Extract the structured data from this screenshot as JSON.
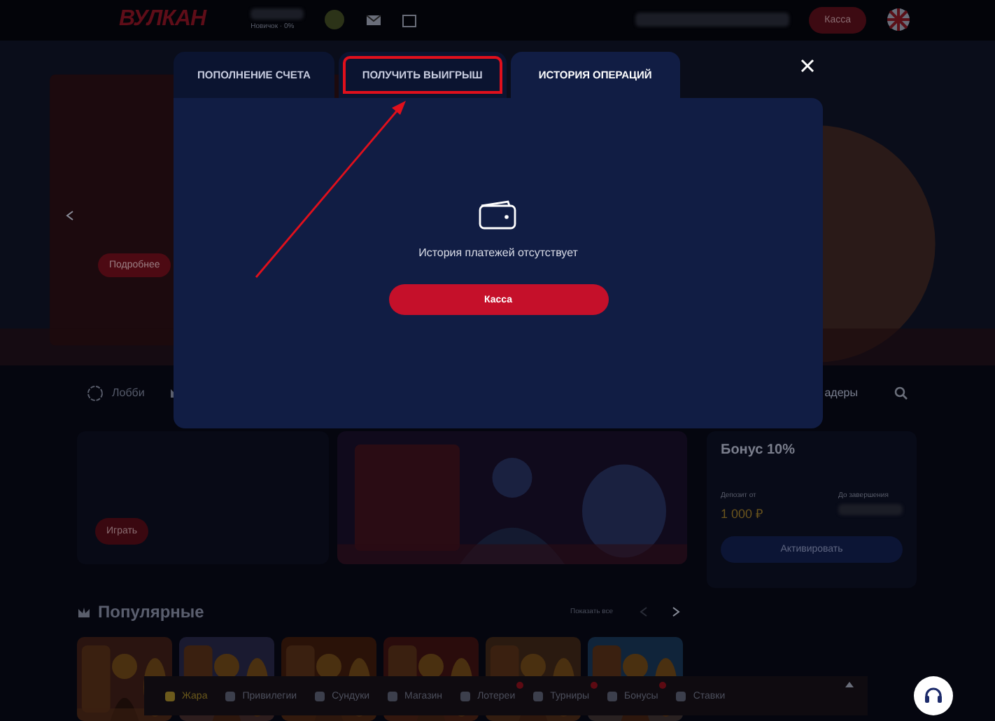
{
  "header": {
    "logo": "ВУЛКАН",
    "status": "Новичок · 0%",
    "cashier": "Касса"
  },
  "hero": {
    "button": "Подробнее"
  },
  "nav": {
    "items": [
      {
        "label": "Лобби"
      }
    ],
    "cut_label": "адеры"
  },
  "promo": {
    "button": "Играть"
  },
  "bonus": {
    "title": "Бонус 10%",
    "deposit_label": "Депозит от",
    "deposit": "1 000 ₽",
    "ends_label": "До завершения",
    "button": "Активировать"
  },
  "popular": {
    "title": "Популярные",
    "show_all": "Показать все"
  },
  "bottom_bar": {
    "items": [
      {
        "label": "Жара",
        "selected": true,
        "badge": false
      },
      {
        "label": "Привилегии",
        "selected": false,
        "badge": false
      },
      {
        "label": "Сундуки",
        "selected": false,
        "badge": false
      },
      {
        "label": "Магазин",
        "selected": false,
        "badge": false
      },
      {
        "label": "Лотереи",
        "selected": false,
        "badge": true
      },
      {
        "label": "Турниры",
        "selected": false,
        "badge": true
      },
      {
        "label": "Бонусы",
        "selected": false,
        "badge": true
      },
      {
        "label": "Ставки",
        "selected": false,
        "badge": false
      }
    ]
  },
  "modal": {
    "tabs": [
      {
        "label": "ПОПОЛНЕНИЕ СЧЕТА",
        "selected": false,
        "highlighted": false
      },
      {
        "label": "ПОЛУЧИТЬ ВЫИГРЫШ",
        "selected": false,
        "highlighted": true
      },
      {
        "label": "ИСТОРИЯ ОПЕРАЦИЙ",
        "selected": true,
        "highlighted": false
      }
    ],
    "empty_message": "История платежей отсутствует",
    "button": "Касса"
  }
}
